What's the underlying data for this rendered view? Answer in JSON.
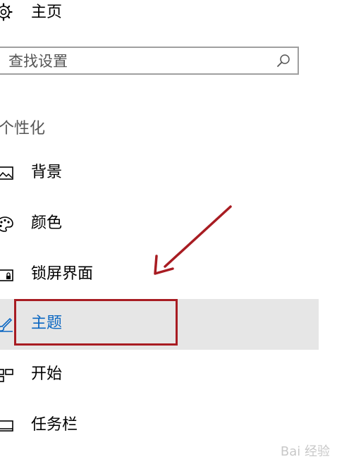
{
  "home": {
    "label": "主页",
    "icon": "gear-icon"
  },
  "search": {
    "placeholder": "查找设置",
    "icon": "search-icon"
  },
  "section": {
    "title": "个性化"
  },
  "nav": {
    "items": [
      {
        "label": "背景",
        "icon": "picture-icon",
        "selected": false
      },
      {
        "label": "颜色",
        "icon": "palette-icon",
        "selected": false
      },
      {
        "label": "锁屏界面",
        "icon": "lock-screen-icon",
        "selected": false
      },
      {
        "label": "主题",
        "icon": "brush-icon",
        "selected": true
      },
      {
        "label": "开始",
        "icon": "start-icon",
        "selected": false
      },
      {
        "label": "任务栏",
        "icon": "taskbar-icon",
        "selected": false
      }
    ]
  },
  "watermark": {
    "text": "Bai  经验"
  },
  "colors": {
    "selected_text": "#0b67c2",
    "selected_background": "#e6e6e6",
    "annotation_red": "#a81c22"
  }
}
